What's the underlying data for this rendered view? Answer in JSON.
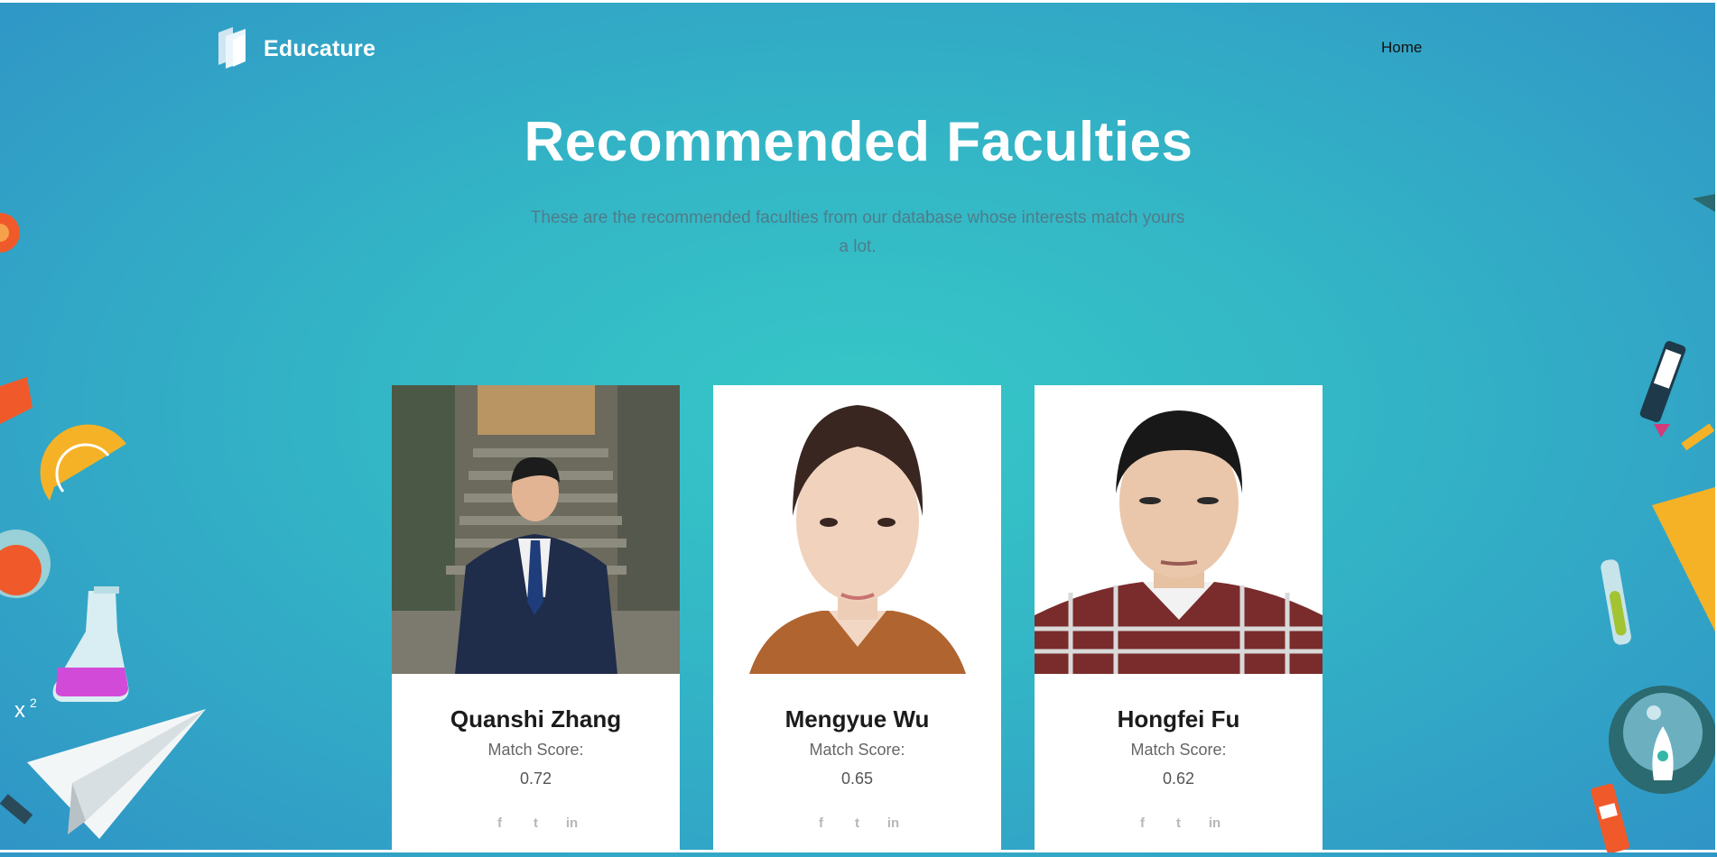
{
  "brand": {
    "name": "Educature",
    "accent": "#33b9c6",
    "logo_icon": "book-logo-icon"
  },
  "nav": {
    "home_label": "Home"
  },
  "hero": {
    "title": "Recommended Faculties",
    "subtitle": "These are the recommended faculties from our database whose interests match yours a lot."
  },
  "faculties": [
    {
      "name": "Quanshi Zhang",
      "score_label": "Match Score:",
      "score": "0.72"
    },
    {
      "name": "Mengyue Wu",
      "score_label": "Match Score:",
      "score": "0.65"
    },
    {
      "name": "Hongfei Fu",
      "score_label": "Match Score:",
      "score": "0.62"
    }
  ],
  "social_icons": [
    "facebook-icon",
    "twitter-icon",
    "linkedin-icon"
  ],
  "social_glyphs": {
    "facebook": "f",
    "twitter": "t",
    "linkedin": "in"
  }
}
